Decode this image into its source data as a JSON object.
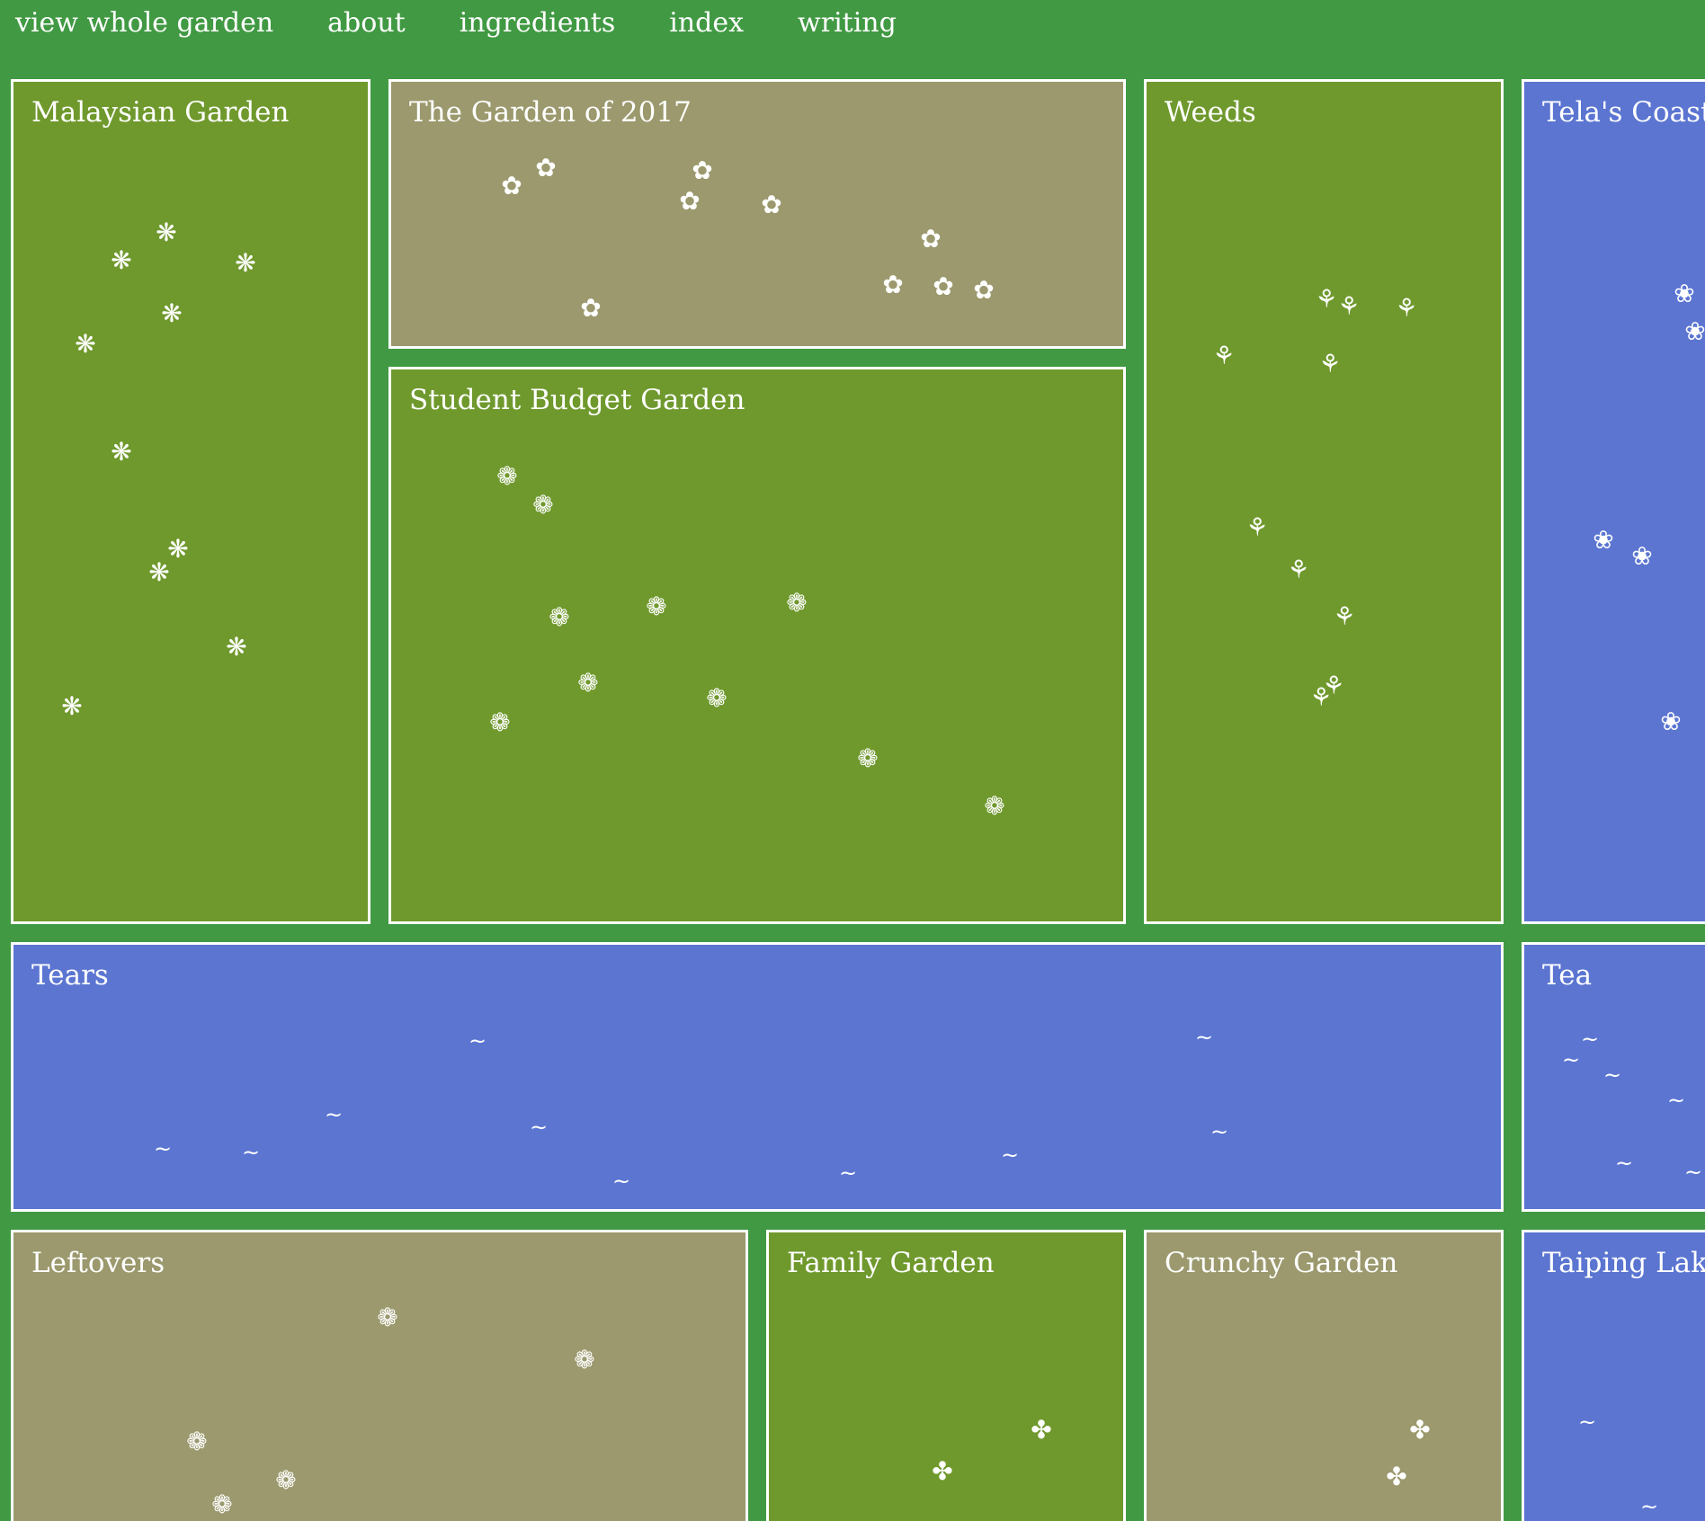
{
  "nav": [
    {
      "key": "view-whole-garden",
      "label": "view whole garden"
    },
    {
      "key": "about",
      "label": "about"
    },
    {
      "key": "ingredients",
      "label": "ingredients"
    },
    {
      "key": "index",
      "label": "index"
    },
    {
      "key": "writing",
      "label": "writing"
    }
  ],
  "colors": {
    "page_background": "#419a43",
    "plot_green": "#6f992d",
    "plot_khaki": "#9b996d",
    "plot_blue": "#5b75d1",
    "border": "#ffffff",
    "text": "#ffffff"
  },
  "glyph_names": {
    "❋": "asterisk-flower-icon",
    "✿": "flower-icon",
    "❁": "dot-flower-icon",
    "⚘": "sprout-icon",
    "❀": "blossom-icon",
    "~": "wave-icon",
    "✤": "clover-icon"
  },
  "gardens": [
    {
      "key": "malaysian-garden",
      "title": "Malaysian Garden",
      "color": "#6f992d",
      "glyph": "❋"
    },
    {
      "key": "the-garden-of-2017",
      "title": "The Garden of 2017",
      "color": "#9b996d",
      "glyph": "✿"
    },
    {
      "key": "student-budget-garden",
      "title": "Student Budget Garden",
      "color": "#6f992d",
      "glyph": "❁"
    },
    {
      "key": "weeds",
      "title": "Weeds",
      "color": "#6f992d",
      "glyph": "⚘"
    },
    {
      "key": "telas-coast",
      "title": "Tela's Coast",
      "color": "#5b75d1",
      "glyph": "❀"
    },
    {
      "key": "tears",
      "title": "Tears",
      "color": "#5b75d1",
      "glyph": "~"
    },
    {
      "key": "tea",
      "title": "Tea",
      "color": "#5b75d1",
      "glyph": "~"
    },
    {
      "key": "leftovers",
      "title": "Leftovers",
      "color": "#9b996d",
      "glyph": "❁"
    },
    {
      "key": "family-garden",
      "title": "Family Garden",
      "color": "#6f992d",
      "glyph": "✤"
    },
    {
      "key": "crunchy-garden",
      "title": "Crunchy Garden",
      "color": "#9b996d",
      "glyph": "✤"
    },
    {
      "key": "taiping-lake",
      "title": "Taiping Lake",
      "color": "#5b75d1",
      "glyph": "~"
    }
  ]
}
